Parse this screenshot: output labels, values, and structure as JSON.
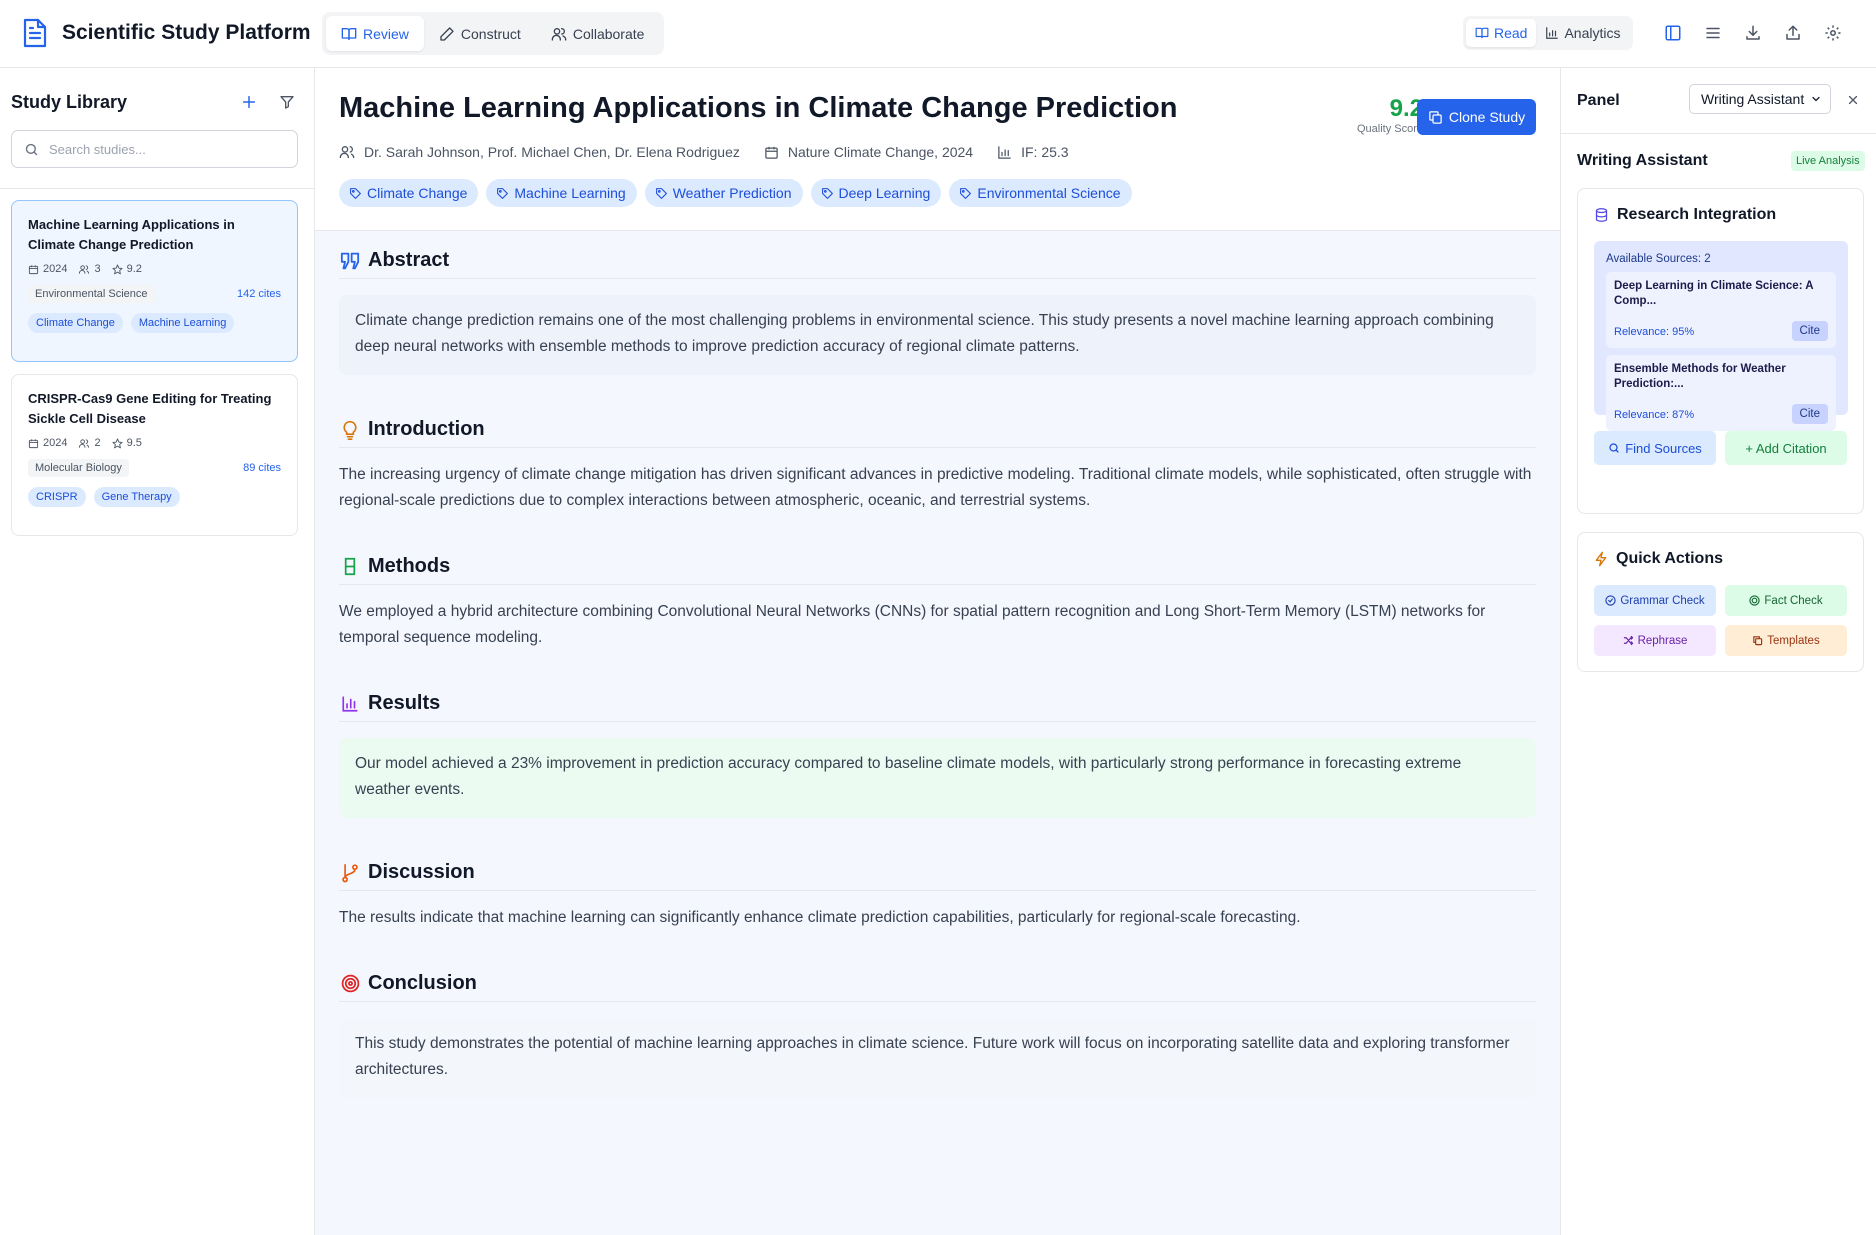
{
  "app": {
    "title": "Scientific Study Platform"
  },
  "mode_tabs": [
    {
      "label": "Review",
      "icon": "book-open-icon",
      "active": true
    },
    {
      "label": "Construct",
      "icon": "pen-icon",
      "active": false
    },
    {
      "label": "Collaborate",
      "icon": "users-icon",
      "active": false
    }
  ],
  "view_toggle": [
    {
      "label": "Read",
      "icon": "book-open-icon",
      "active": true
    },
    {
      "label": "Analytics",
      "icon": "bar-chart-icon",
      "active": false
    }
  ],
  "toolbar_icons": [
    "sidebar-toggle-icon",
    "menu-icon",
    "download-icon",
    "share-icon",
    "settings-icon"
  ],
  "colors": {
    "accent": "#2563eb",
    "quality": "#16a34a",
    "tag_bg": "#dbeafe"
  },
  "sidebar": {
    "title": "Study Library",
    "search_placeholder": "Search studies...",
    "studies": [
      {
        "title": "Machine Learning Applications in Climate Change Prediction",
        "year": "2024",
        "authors": "3",
        "score": "9.2",
        "field": "Environmental Science",
        "cites": "142 cites",
        "tags": [
          "Climate Change",
          "Machine Learning"
        ],
        "selected": true
      },
      {
        "title": "CRISPR-Cas9 Gene Editing for Treating Sickle Cell Disease",
        "year": "2024",
        "authors": "2",
        "score": "9.5",
        "field": "Molecular Biology",
        "cites": "89 cites",
        "tags": [
          "CRISPR",
          "Gene Therapy"
        ],
        "selected": false
      }
    ]
  },
  "paper": {
    "title": "Machine Learning Applications in Climate Change Prediction",
    "authors": "Dr. Sarah Johnson, Prof. Michael Chen, Dr. Elena Rodriguez",
    "journal": "Nature Climate Change, 2024",
    "impact": "IF: 25.3",
    "quality_score": "9.2",
    "quality_label": "Quality Score",
    "clone_label": "Clone Study",
    "tags": [
      "Climate Change",
      "Machine Learning",
      "Weather Prediction",
      "Deep Learning",
      "Environmental Science"
    ],
    "sections": [
      {
        "title": "Abstract",
        "icon": "quote-icon",
        "style": "boxed",
        "body": "Climate change prediction remains one of the most challenging problems in environmental science. This study presents a novel machine learning approach combining deep neural networks with ensemble methods to improve prediction accuracy of regional climate patterns."
      },
      {
        "title": "Introduction",
        "icon": "lightbulb-icon",
        "style": "plain",
        "body": "The increasing urgency of climate change mitigation has driven significant advances in predictive modeling. Traditional climate models, while sophisticated, often struggle with regional-scale predictions due to complex interactions between atmospheric, oceanic, and terrestrial systems."
      },
      {
        "title": "Methods",
        "icon": "beaker-icon",
        "style": "plain",
        "body": "We employed a hybrid architecture combining Convolutional Neural Networks (CNNs) for spatial pattern recognition and Long Short-Term Memory (LSTM) networks for temporal sequence modeling."
      },
      {
        "title": "Results",
        "icon": "bar-chart-icon",
        "style": "boxed-green",
        "body": "Our model achieved a 23% improvement in prediction accuracy compared to baseline climate models, with particularly strong performance in forecasting extreme weather events."
      },
      {
        "title": "Discussion",
        "icon": "git-branch-icon",
        "style": "plain",
        "body": "The results indicate that machine learning can significantly enhance climate prediction capabilities, particularly for regional-scale forecasting."
      },
      {
        "title": "Conclusion",
        "icon": "target-icon",
        "style": "boxed-gray",
        "body": "This study demonstrates the potential of machine learning approaches in climate science. Future work will focus on incorporating satellite data and exploring transformer architectures."
      }
    ]
  },
  "panel": {
    "label": "Panel",
    "selected_view": "Writing Assistant",
    "title": "Writing Assistant",
    "badge": "Live Analysis",
    "research": {
      "title": "Research Integration",
      "sources_count": "Available Sources: 2",
      "sources": [
        {
          "title": "Deep Learning in Climate Science: A Comp...",
          "relevance": "Relevance: 95%",
          "cite": "Cite"
        },
        {
          "title": "Ensemble Methods for Weather Prediction:...",
          "relevance": "Relevance: 87%",
          "cite": "Cite"
        }
      ],
      "find_sources": "Find Sources",
      "add_citation": "+ Add Citation"
    },
    "quick_actions": {
      "title": "Quick Actions",
      "buttons": [
        {
          "label": "Grammar Check",
          "icon": "check-circle-icon"
        },
        {
          "label": "Fact Check",
          "icon": "target-icon"
        },
        {
          "label": "Rephrase",
          "icon": "shuffle-icon"
        },
        {
          "label": "Templates",
          "icon": "copy-icon"
        }
      ]
    }
  }
}
